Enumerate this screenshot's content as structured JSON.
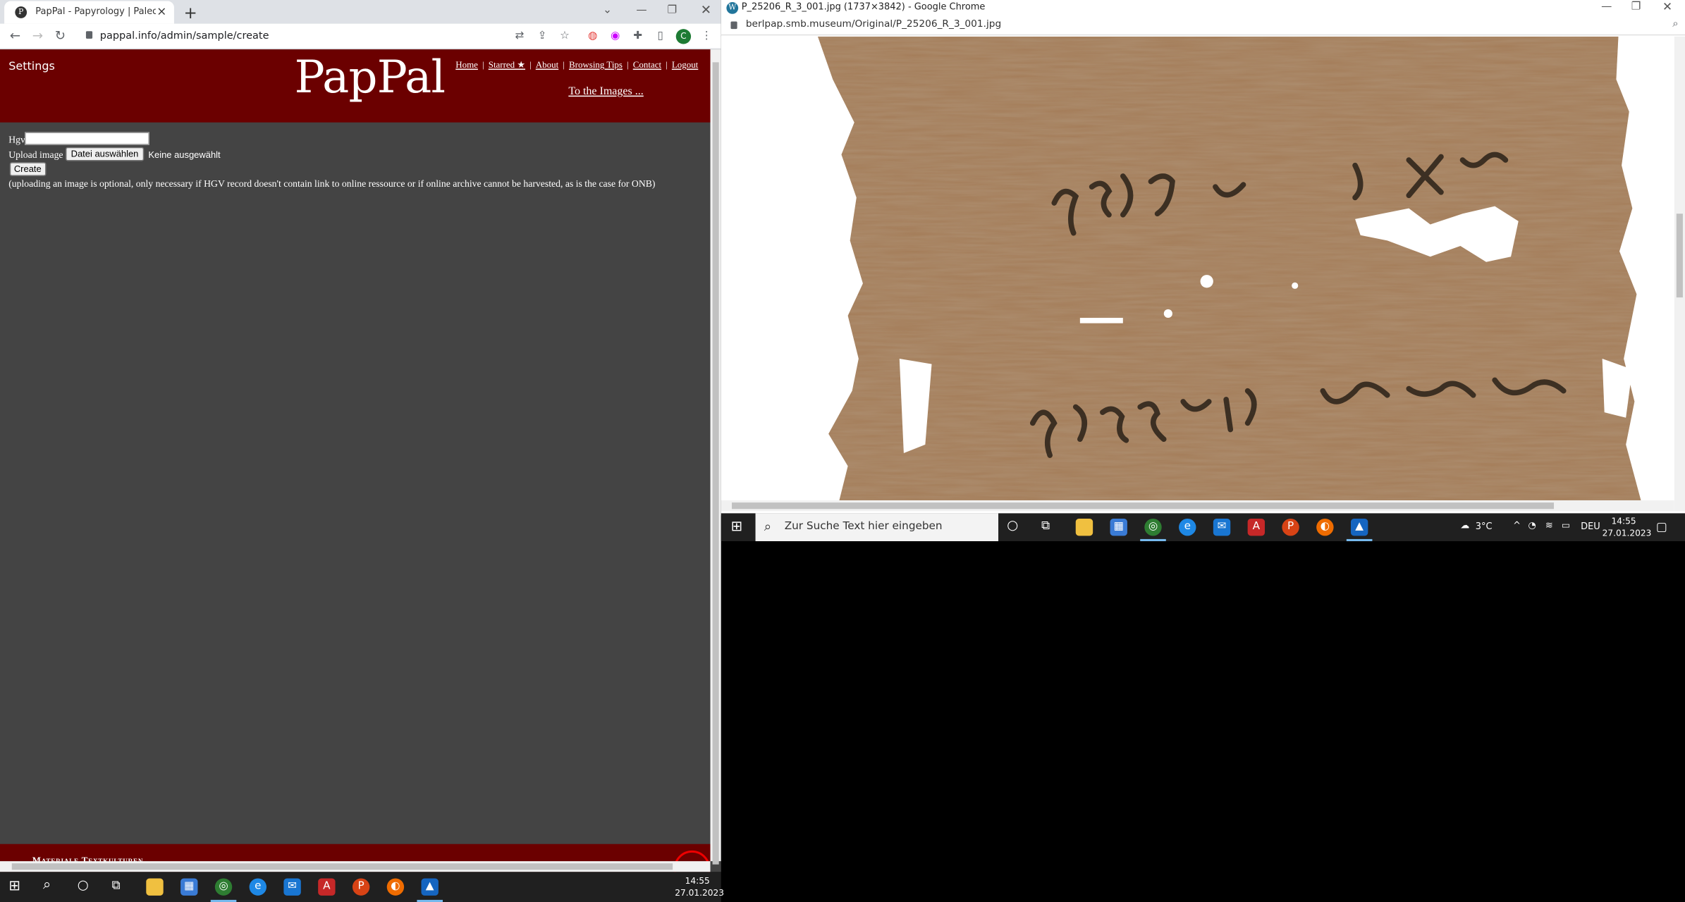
{
  "left_window": {
    "tab_title": "PapPal - Papyrology | Paleography",
    "url": "pappal.info/admin/sample/create",
    "profile_initial": "C"
  },
  "pappal": {
    "settings": "Settings",
    "logo": "PapPal",
    "nav": [
      "Home",
      "Starred ★",
      "About",
      "Browsing Tips",
      "Contact",
      "Logout"
    ],
    "to_images": "To the Images ...",
    "form": {
      "hgv_label": "Hgv",
      "hgv_value": "",
      "upload_label": "Upload image",
      "file_button": "Datei auswählen",
      "file_status": "Keine ausgewählt",
      "create_button": "Create",
      "note": "(uploading an image is optional, only necessary if HGV record doesn't contain link to online ressource or if online archive cannot be harvested, as is the case for ONB)"
    },
    "footer": "Materiale Textkulturen"
  },
  "right_window": {
    "title": "P_25206_R_3_001.jpg (1737×3842) - Google Chrome",
    "url": "berlpap.smb.museum/Original/P_25206_R_3_001.jpg"
  },
  "taskbar_right": {
    "search_placeholder": "Zur Suche Text hier eingeben",
    "weather": "3°C",
    "language": "DEU",
    "time": "14:55",
    "date": "27.01.2023"
  },
  "taskbar_left": {
    "time": "14:55",
    "date": "27.01.2023"
  },
  "colors": {
    "pappal_red": "#6b0000",
    "page_bg": "#444444"
  }
}
